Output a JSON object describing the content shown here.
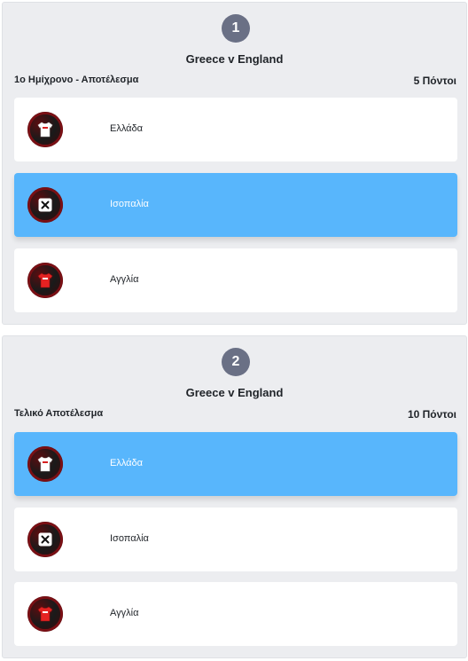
{
  "questions": [
    {
      "number": "1",
      "match": "Greece v England",
      "market": "1ο Ημίχρονο - Αποτέλεσμα",
      "points": "5 Πόντοι",
      "options": [
        {
          "label": "Ελλάδα",
          "icon": "home-shirt-icon",
          "selected": false
        },
        {
          "label": "Ισοπαλία",
          "icon": "draw-x-icon",
          "selected": true
        },
        {
          "label": "Αγγλία",
          "icon": "away-shirt-icon",
          "selected": false
        }
      ]
    },
    {
      "number": "2",
      "match": "Greece v England",
      "market": "Τελικό Αποτέλεσμα",
      "points": "10 Πόντοι",
      "options": [
        {
          "label": "Ελλάδα",
          "icon": "home-shirt-icon",
          "selected": true
        },
        {
          "label": "Ισοπαλία",
          "icon": "draw-x-icon",
          "selected": false
        },
        {
          "label": "Αγγλία",
          "icon": "away-shirt-icon",
          "selected": false
        }
      ]
    }
  ],
  "colors": {
    "card_bg": "#ecedf0",
    "badge": "#6a7085",
    "selected": "#58b6fc",
    "option_bg": "#ffffff"
  }
}
